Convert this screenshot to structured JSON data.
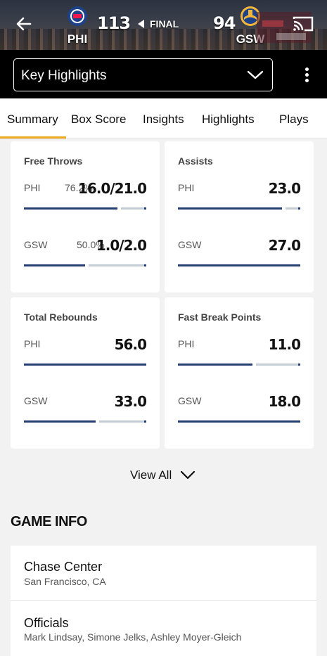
{
  "header": {
    "home_abbr": "PHI",
    "home_score": "113",
    "status": "FINAL",
    "away_score": "94",
    "away_abbr": "GSW",
    "colors": {
      "phi_blue": "#1d428a",
      "gsw_gold": "#f2b63a"
    }
  },
  "selector": {
    "label": "Key Highlights"
  },
  "tabs": [
    "Summary",
    "Box Score",
    "Insights",
    "Highlights",
    "Plays"
  ],
  "active_tab": "Summary",
  "stats": [
    {
      "title": "Free Throws",
      "rows": [
        {
          "team": "PHI",
          "pct": "76.2%",
          "value": "16.0/21.0",
          "fill": 0.762
        },
        {
          "team": "GSW",
          "pct": "50.0%",
          "value": "1.0/2.0",
          "fill": 0.5
        }
      ]
    },
    {
      "title": "Assists",
      "rows": [
        {
          "team": "PHI",
          "pct": "",
          "value": "23.0",
          "fill": 0.852
        },
        {
          "team": "GSW",
          "pct": "",
          "value": "27.0",
          "fill": 1.0
        }
      ]
    },
    {
      "title": "Total Rebounds",
      "rows": [
        {
          "team": "PHI",
          "pct": "",
          "value": "56.0",
          "fill": 1.0
        },
        {
          "team": "GSW",
          "pct": "",
          "value": "33.0",
          "fill": 0.589
        }
      ]
    },
    {
      "title": "Fast Break Points",
      "rows": [
        {
          "team": "PHI",
          "pct": "",
          "value": "11.0",
          "fill": 0.611
        },
        {
          "team": "GSW",
          "pct": "",
          "value": "18.0",
          "fill": 1.0
        }
      ]
    }
  ],
  "view_all": "View All",
  "game_info": {
    "title": "GAME INFO",
    "venue": {
      "name": "Chase Center",
      "location": "San Francisco, CA"
    },
    "officials": {
      "label": "Officials",
      "names": "Mark Lindsay, Simone Jelks, Ashley Moyer-Gleich"
    }
  }
}
